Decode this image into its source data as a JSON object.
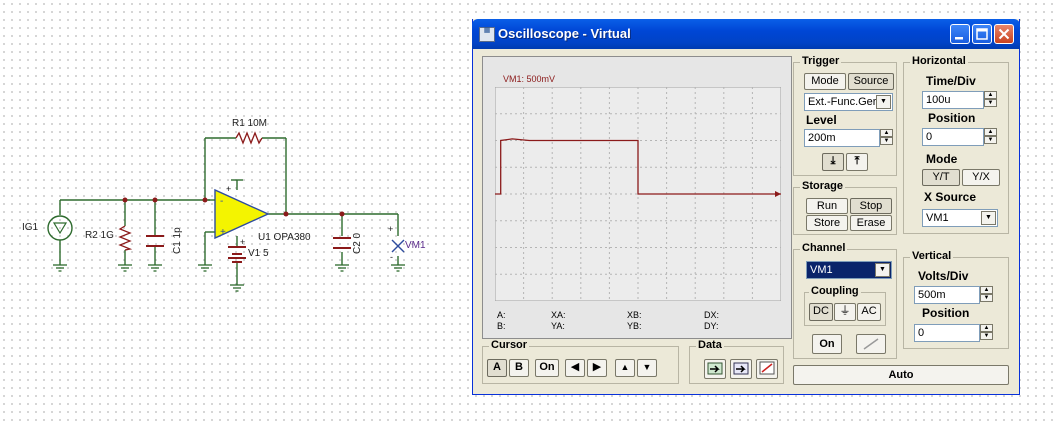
{
  "schematic": {
    "labels": {
      "ig1": "IG1",
      "r1": "R1 10M",
      "r2": "R2 1G",
      "c1": "C1 1p",
      "u1": "U1 OPA380",
      "v1": "V1 5",
      "c2": "C2 0",
      "vm1": "VM1",
      "plus": "+",
      "minus": "-"
    }
  },
  "window": {
    "title": "Oscilloscope - Virtual"
  },
  "screen": {
    "channel_label": "VM1: 500mV",
    "readouts": {
      "a": "A:",
      "b": "B:",
      "xa": "XA:",
      "ya": "YA:",
      "xb": "XB:",
      "yb": "YB:",
      "dx": "DX:",
      "dy": "DY:"
    }
  },
  "trigger": {
    "title": "Trigger",
    "mode_label": "Mode",
    "source_label": "Source",
    "source_value": "Ext.-Func.Ger",
    "level_label": "Level",
    "level_value": "200m"
  },
  "storage": {
    "title": "Storage",
    "run_label": "Run",
    "stop_label": "Stop",
    "store_label": "Store",
    "erase_label": "Erase"
  },
  "channel": {
    "title": "Channel",
    "selected": "VM1",
    "coupling_title": "Coupling",
    "dc_label": "DC",
    "gnd_glyph": "⏚",
    "ac_label": "AC",
    "on_label": "On"
  },
  "horizontal": {
    "title": "Horizontal",
    "time_div_label": "Time/Div",
    "time_div_value": "100u",
    "position_label": "Position",
    "position_value": "0",
    "mode_label": "Mode",
    "yt_label": "Y/T",
    "yx_label": "Y/X",
    "xsource_label": "X Source",
    "xsource_value": "VM1"
  },
  "vertical": {
    "title": "Vertical",
    "volts_div_label": "Volts/Div",
    "volts_div_value": "500m",
    "position_label": "Position",
    "position_value": "0"
  },
  "cursor": {
    "title": "Cursor",
    "a_label": "A",
    "b_label": "B",
    "on_label": "On"
  },
  "data_group": {
    "title": "Data"
  },
  "auto_label": "Auto",
  "colors": {
    "trace": "#8b1a1a",
    "opamp_fill": "#f4f400",
    "wire": "#2e6b2e",
    "titlebar": "#0a5fe8",
    "panel": "#ece9d8"
  },
  "waveform": {
    "points": [
      [
        0,
        0
      ],
      [
        0.02,
        0
      ],
      [
        0.02,
        1.0
      ],
      [
        0.06,
        1.03
      ],
      [
        0.12,
        1.0
      ],
      [
        0.5,
        1.0
      ],
      [
        0.5,
        0
      ],
      [
        1.0,
        0
      ]
    ],
    "time_divs": 10,
    "volt_divs": 8
  }
}
